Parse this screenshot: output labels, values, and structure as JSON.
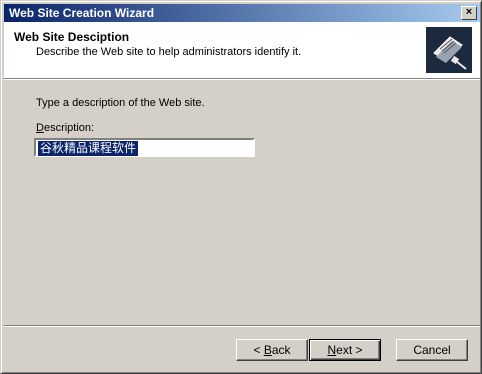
{
  "window": {
    "title": "Web Site Creation Wizard",
    "close_glyph": "×"
  },
  "header": {
    "title": "Web Site Desciption",
    "subtitle": "Describe the Web site to help administrators identify it.",
    "icon": "wizard-book-icon"
  },
  "main": {
    "instruction": "Type a description of the Web site.",
    "description_label_accel": "D",
    "description_label_rest": "escription:",
    "description_value": "谷秋精品课程软件"
  },
  "buttons": {
    "back_prefix": "< ",
    "back_accel": "B",
    "back_rest": "ack",
    "next_accel": "N",
    "next_rest": "ext >",
    "cancel": "Cancel"
  },
  "colors": {
    "face": "#d4d0c8",
    "titlebar_start": "#0a246a",
    "titlebar_end": "#a6caf0",
    "selection": "#0a246a"
  }
}
